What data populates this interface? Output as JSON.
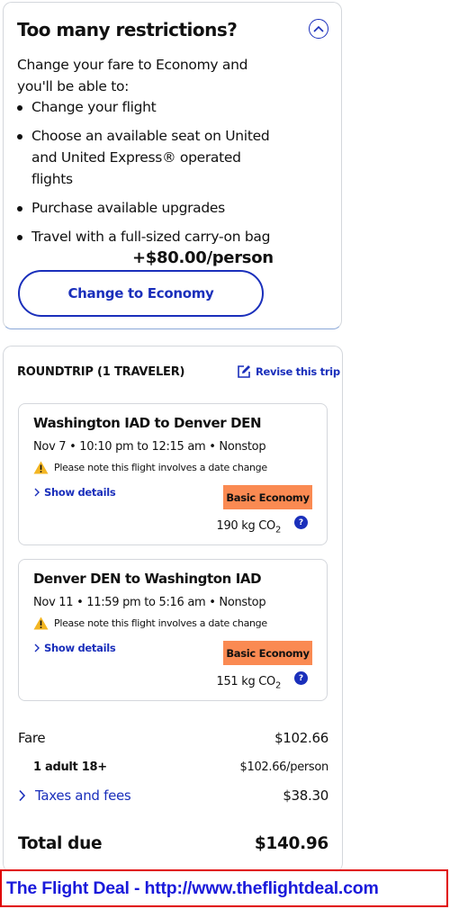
{
  "upsell": {
    "title": "Too many restrictions?",
    "intro": "Change your fare to Economy and you'll be able to:",
    "benefits": [
      "Change your flight",
      "Choose an available seat on United and United Express® operated flights",
      "Purchase available upgrades",
      "Travel with a full-sized carry-on bag"
    ],
    "price": "+$80.00/person",
    "button": "Change to Economy"
  },
  "trip": {
    "heading": "ROUNDTRIP (1 TRAVELER)",
    "revise": "Revise this trip",
    "segments": [
      {
        "route": "Washington IAD to Denver DEN",
        "times": "Nov 7 • 10:10 pm to 12:15 am • Nonstop",
        "warning": "Please note this flight involves a date change",
        "details": "Show details",
        "fare": "Basic Economy",
        "co2": "190 kg CO",
        "co2_sub": "2",
        "help": "?"
      },
      {
        "route": "Denver DEN to Washington IAD",
        "times": "Nov 11 • 11:59 pm to 5:16 am • Nonstop",
        "warning": "Please note this flight involves a date change",
        "details": "Show details",
        "fare": "Basic Economy",
        "co2": "151 kg CO",
        "co2_sub": "2",
        "help": "?"
      }
    ]
  },
  "summary": {
    "fare_label": "Fare",
    "fare_value": "$102.66",
    "adult_label": "1 adult 18+",
    "adult_value": "$102.66/person",
    "taxes_label": "Taxes and fees",
    "taxes_value": "$38.30",
    "total_label": "Total due",
    "total_value": "$140.96"
  },
  "footer": {
    "text": "The Flight Deal - http://www.theflightdeal.com"
  },
  "colors": {
    "accent": "#1a2fbb",
    "badge": "#fa8a52",
    "footer_border": "#e00000"
  }
}
